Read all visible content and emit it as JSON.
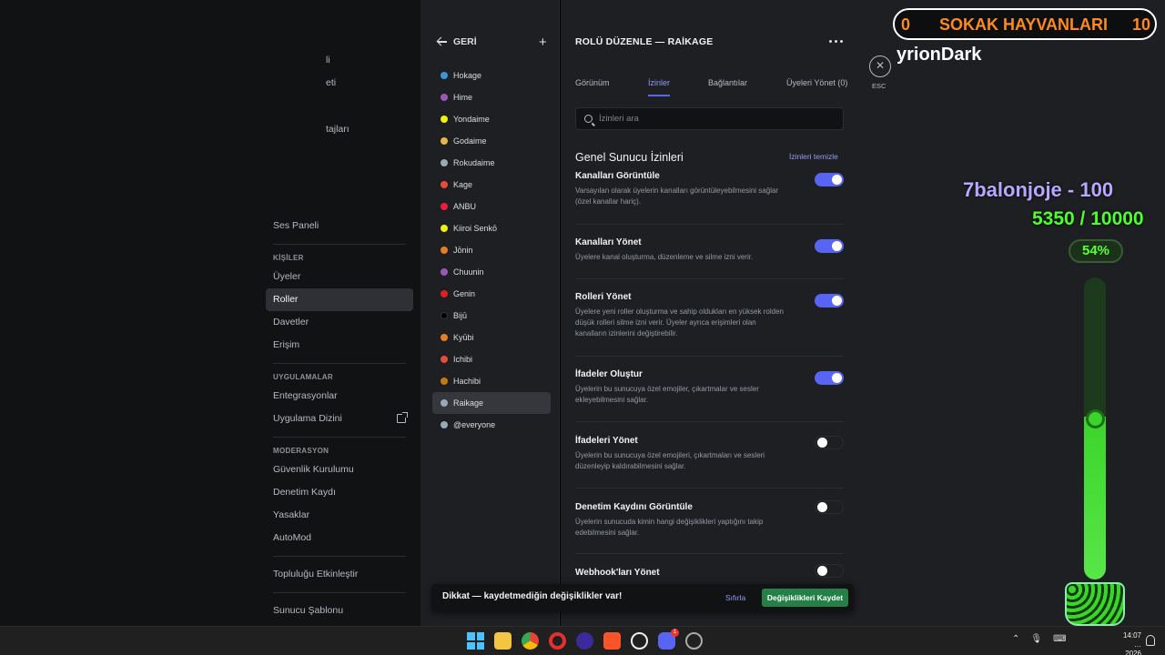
{
  "sidebar": {
    "partials": [
      "li",
      "eti",
      "tajları"
    ],
    "voice_panel": "Ses Paneli",
    "people_header": "KİŞİLER",
    "people": [
      {
        "label": "Üyeler",
        "active": false
      },
      {
        "label": "Roller",
        "active": true
      },
      {
        "label": "Davetler",
        "active": false
      },
      {
        "label": "Erişim",
        "active": false
      }
    ],
    "apps_header": "UYGULAMALAR",
    "apps": [
      "Entegrasyonlar",
      "Uygulama Dizini"
    ],
    "mod_header": "MODERASYON",
    "mod": [
      "Güvenlik Kurulumu",
      "Denetim Kaydı",
      "Yasaklar",
      "AutoMod"
    ],
    "community": "Topluluğu Etkinleştir",
    "template": "Sunucu Şablonu"
  },
  "roles_panel": {
    "back_label": "GERİ",
    "add_icon": "plus-icon",
    "roles": [
      {
        "name": "Hokage",
        "color": "#3498db"
      },
      {
        "name": "Hime",
        "color": "#9b59b6"
      },
      {
        "name": "Yondaime",
        "color": "#f1f10f"
      },
      {
        "name": "Godaime",
        "color": "#e1b84e"
      },
      {
        "name": "Rokudaime",
        "color": "#99aab5"
      },
      {
        "name": "Kage",
        "color": "#e74c3c"
      },
      {
        "name": "ANBU",
        "color": "#e91e3c"
      },
      {
        "name": "Kiiroi Senkō",
        "color": "#f1f10f"
      },
      {
        "name": "Jōnin",
        "color": "#e67e22"
      },
      {
        "name": "Chuunin",
        "color": "#9b59b6"
      },
      {
        "name": "Genin",
        "color": "#e02020"
      },
      {
        "name": "Bijū",
        "color": "#000000"
      },
      {
        "name": "Kyūbi",
        "color": "#e67e22"
      },
      {
        "name": "Ichibi",
        "color": "#e74c3c"
      },
      {
        "name": "Hachibi",
        "color": "#c27c0e"
      },
      {
        "name": "Raikage",
        "color": "#99aab5",
        "selected": true
      },
      {
        "name": "@everyone",
        "color": "#99aab5"
      }
    ]
  },
  "edit": {
    "title": "ROLÜ DÜZENLE — RAİKAGE",
    "tabs": [
      {
        "label": "Görünüm",
        "active": false
      },
      {
        "label": "İzinler",
        "active": true
      },
      {
        "label": "Bağlantılar",
        "active": false
      },
      {
        "label": "Üyeleri Yönet (0)",
        "active": false
      }
    ],
    "search_placeholder": "İzinleri ara",
    "section_title": "Genel Sunucu İzinleri",
    "clear_label": "İzinleri temizle",
    "permissions": [
      {
        "name": "Kanalları Görüntüle",
        "desc": "Varsayılan olarak üyelerin kanalları görüntüleyebilmesini sağlar (özel kanallar hariç).",
        "on": true
      },
      {
        "name": "Kanalları Yönet",
        "desc": "Üyelere kanal oluşturma, düzenleme ve silme izni verir.",
        "on": true
      },
      {
        "name": "Rolleri Yönet",
        "desc": "Üyelere yeni roller oluşturma ve sahip oldukları en yüksek rolden düşük rolleri silme izni verir. Üyeler ayrıca erişimleri olan kanalların izinlerini değiştirebilir.",
        "on": true
      },
      {
        "name": "İfadeler Oluştur",
        "desc": "Üyelerin bu sunucuya özel emojiler, çıkartmalar ve sesler ekleyebilmesini sağlar.",
        "on": true
      },
      {
        "name": "İfadeleri Yönet",
        "desc": "Üyelerin bu sunucuya özel emojileri, çıkartmaları ve sesleri düzenleyip kaldırabilmesini sağlar.",
        "on": false
      },
      {
        "name": "Denetim Kaydını Görüntüle",
        "desc": "Üyelerin sunucuda kimin hangi değişiklikleri yaptığını takip edebilmesini sağlar.",
        "on": false
      },
      {
        "name": "Webhook'ları Yönet",
        "desc": "",
        "on": false
      }
    ]
  },
  "unsaved": {
    "message": "Dikkat — kaydetmediğin değişiklikler var!",
    "reset": "Sıfırla",
    "save": "Değişiklikleri Kaydet"
  },
  "esc_label": "ESC",
  "overlay": {
    "left_num": "0",
    "title": "SOKAK HAYVANLARI",
    "right_num": "10",
    "user": "yrionDark",
    "goal": "7balonjoje - 100",
    "progress": "5350 / 10000",
    "percent_label": "54%",
    "percent": 0.54
  },
  "taskbar": {
    "time": "14:07",
    "date": "…2026",
    "discord_badge": "1"
  }
}
